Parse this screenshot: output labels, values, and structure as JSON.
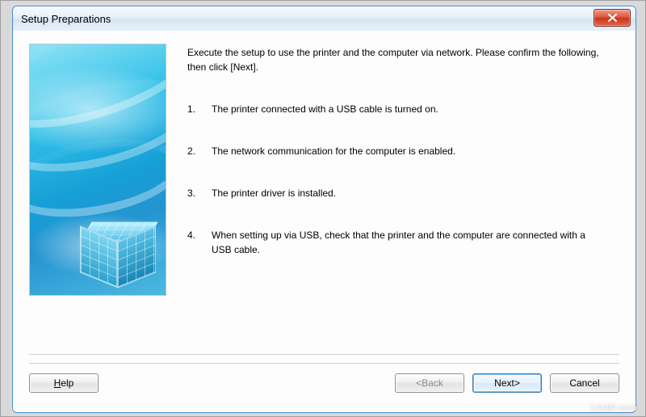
{
  "window": {
    "title": "Setup Preparations",
    "close_tooltip": "Close"
  },
  "intro": "Execute the setup to use the printer and the computer via network. Please confirm the following, then click [Next].",
  "steps": [
    {
      "num": "1.",
      "text": "The printer connected with a USB cable is turned on."
    },
    {
      "num": "2.",
      "text": "The network communication for the computer is enabled."
    },
    {
      "num": "3.",
      "text": "The printer driver is installed."
    },
    {
      "num": "4.",
      "text": "When setting up via USB, check that the printer and the computer are connected with a USB cable."
    }
  ],
  "buttons": {
    "help_prefix": "H",
    "help_rest": "elp",
    "back": "<Back",
    "next": "Next>",
    "cancel": "Cancel"
  },
  "watermark": "LO4D.com"
}
